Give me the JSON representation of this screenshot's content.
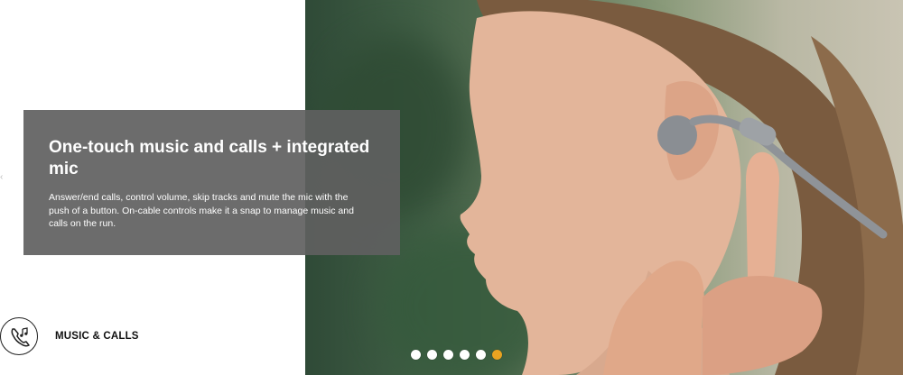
{
  "overlay": {
    "title": "One-touch music and calls + integrated mic",
    "description": "Answer/end calls, control volume, skip tracks and mute the mic with the push of a button. On-cable controls make it a snap to manage music and calls on the run."
  },
  "feature": {
    "label": "MUSIC & CALLS",
    "icon": "phone-music-icon"
  },
  "carousel": {
    "slide_count": 6,
    "active_index": 5,
    "active_color": "#e9a321"
  },
  "hero": {
    "image": "woman-wearing-earbuds-photo"
  }
}
